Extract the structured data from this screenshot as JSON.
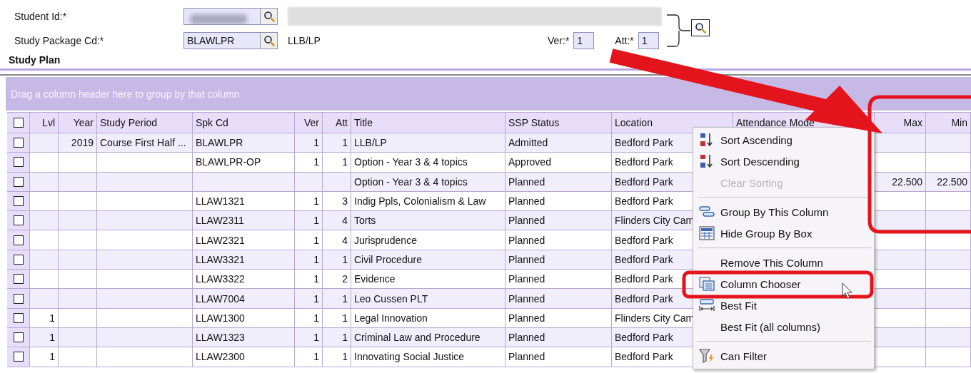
{
  "form": {
    "student_id_label": "Student Id:*",
    "study_package_label": "Study Package Cd:*",
    "study_package_value": "BLAWLPR",
    "study_package_title": "LLB/LP",
    "ver_label": "Ver:*",
    "ver_value": "1",
    "att_label": "Att:*",
    "att_value": "1"
  },
  "section_title": "Study Plan",
  "grid": {
    "group_panel_hint": "Drag a column header here to group by that column",
    "header_checked": false,
    "columns": [
      {
        "label": "Lvl"
      },
      {
        "label": "Year"
      },
      {
        "label": "Study Period"
      },
      {
        "label": "Spk Cd"
      },
      {
        "label": "Ver"
      },
      {
        "label": "Att"
      },
      {
        "label": "Title"
      },
      {
        "label": "SSP Status"
      },
      {
        "label": "Location"
      },
      {
        "label": "Attendance Mode"
      },
      {
        "label": "Max"
      },
      {
        "label": "Min"
      }
    ],
    "rows": [
      {
        "checked": false,
        "cells": [
          null,
          "2019",
          "Course First Half ...",
          "BLAWLPR",
          "1",
          "1",
          "LLB/LP",
          "Admitted",
          "Bedford Park",
          null,
          null,
          null
        ]
      },
      {
        "checked": false,
        "cells": [
          null,
          null,
          null,
          "BLAWLPR-OP",
          "1",
          "1",
          "Option - Year 3 & 4 topics",
          "Approved",
          "Bedford Park",
          null,
          null,
          null
        ]
      },
      {
        "checked": false,
        "cells": [
          null,
          null,
          null,
          null,
          null,
          null,
          "Option - Year 3 & 4 topics",
          "Planned",
          "Bedford Park",
          null,
          "22.500",
          "22.500"
        ]
      },
      {
        "checked": false,
        "cells": [
          null,
          null,
          null,
          "LLAW1321",
          "1",
          "3",
          "Indig Ppls, Colonialism & Law",
          "Planned",
          "Bedford Park",
          null,
          null,
          null
        ]
      },
      {
        "checked": false,
        "cells": [
          null,
          null,
          null,
          "LLAW2311",
          "1",
          "4",
          "Torts",
          "Planned",
          "Flinders City Cam",
          null,
          null,
          null
        ]
      },
      {
        "checked": false,
        "cells": [
          null,
          null,
          null,
          "LLAW2321",
          "1",
          "4",
          "Jurisprudence",
          "Planned",
          "Bedford Park",
          null,
          null,
          null
        ]
      },
      {
        "checked": false,
        "cells": [
          null,
          null,
          null,
          "LLAW3321",
          "1",
          "1",
          "Civil Procedure",
          "Planned",
          "Bedford Park",
          null,
          null,
          null
        ]
      },
      {
        "checked": false,
        "cells": [
          null,
          null,
          null,
          "LLAW3322",
          "1",
          "2",
          "Evidence",
          "Planned",
          "Bedford Park",
          null,
          null,
          null
        ]
      },
      {
        "checked": false,
        "cells": [
          null,
          null,
          null,
          "LLAW7004",
          "1",
          "1",
          "Leo Cussen PLT",
          "Planned",
          "Bedford Park",
          null,
          null,
          null
        ]
      },
      {
        "checked": false,
        "cells": [
          "1",
          null,
          null,
          "LLAW1300",
          "1",
          "1",
          "Legal Innovation",
          "Planned",
          "Flinders City Cam",
          null,
          null,
          null
        ]
      },
      {
        "checked": false,
        "cells": [
          "1",
          null,
          null,
          "LLAW1323",
          "1",
          "1",
          "Criminal Law and Procedure",
          "Planned",
          "Bedford Park",
          null,
          null,
          null
        ]
      },
      {
        "checked": false,
        "cells": [
          "1",
          null,
          null,
          "LLAW2300",
          "1",
          "1",
          "Innovating Social Justice",
          "Planned",
          "Bedford Park",
          null,
          null,
          null
        ]
      }
    ]
  },
  "context_menu": {
    "items": [
      {
        "kind": "item",
        "label": "Sort Ascending",
        "disabled": false
      },
      {
        "kind": "item",
        "label": "Sort Descending",
        "disabled": false
      },
      {
        "kind": "item",
        "label": "Clear Sorting",
        "disabled": true
      },
      {
        "kind": "separator"
      },
      {
        "kind": "item",
        "label": "Group By This Column",
        "disabled": false
      },
      {
        "kind": "item",
        "label": "Hide Group By Box",
        "disabled": false
      },
      {
        "kind": "separator"
      },
      {
        "kind": "item",
        "label": "Remove This Column",
        "disabled": false
      },
      {
        "kind": "item",
        "label": "Column Chooser",
        "disabled": false
      },
      {
        "kind": "item",
        "label": "Best Fit",
        "disabled": false
      },
      {
        "kind": "item",
        "label": "Best Fit (all columns)",
        "disabled": false
      },
      {
        "kind": "separator"
      },
      {
        "kind": "item",
        "label": "Can Filter",
        "disabled": false
      }
    ]
  }
}
